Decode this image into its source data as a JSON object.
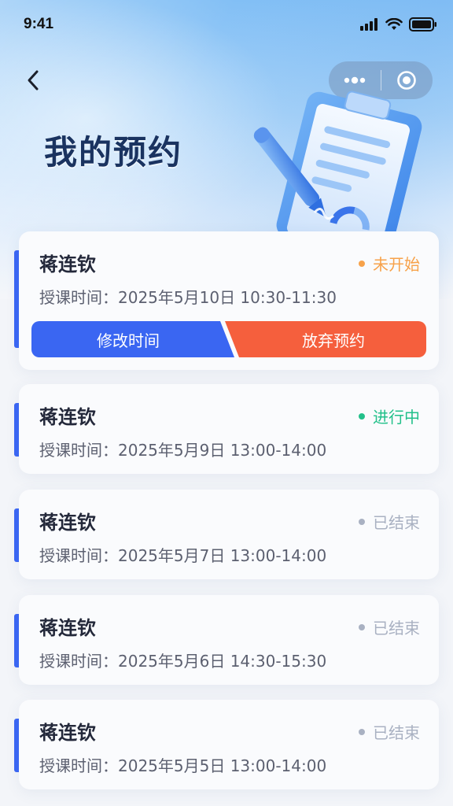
{
  "status_bar": {
    "time": "9:41"
  },
  "nav": {
    "back_icon": "chevron-left-icon",
    "more_icon": "more-dots-icon",
    "close_icon": "target-circle-icon"
  },
  "page": {
    "title": "我的预约"
  },
  "colors": {
    "accent_blue": "#3a66f2",
    "danger_orange": "#f55f3d",
    "status_pending": "#f7a24a",
    "status_active": "#22c08a",
    "status_ended": "#a9b1c2"
  },
  "appointments": [
    {
      "name": "蒋连钦",
      "time_label": "授课时间：",
      "time_value": "2025年5月10日 10:30-11:30",
      "status": "未开始",
      "modify_label": "修改时间",
      "abandon_label": "放弃预约"
    },
    {
      "name": "蒋连钦",
      "time_label": "授课时间：",
      "time_value": "2025年5月9日 13:00-14:00",
      "status": "进行中"
    },
    {
      "name": "蒋连钦",
      "time_label": "授课时间：",
      "time_value": "2025年5月7日 13:00-14:00",
      "status": "已结束"
    },
    {
      "name": "蒋连钦",
      "time_label": "授课时间：",
      "time_value": "2025年5月6日 14:30-15:30",
      "status": "已结束"
    },
    {
      "name": "蒋连钦",
      "time_label": "授课时间：",
      "time_value": "2025年5月5日 13:00-14:00",
      "status": "已结束"
    }
  ]
}
